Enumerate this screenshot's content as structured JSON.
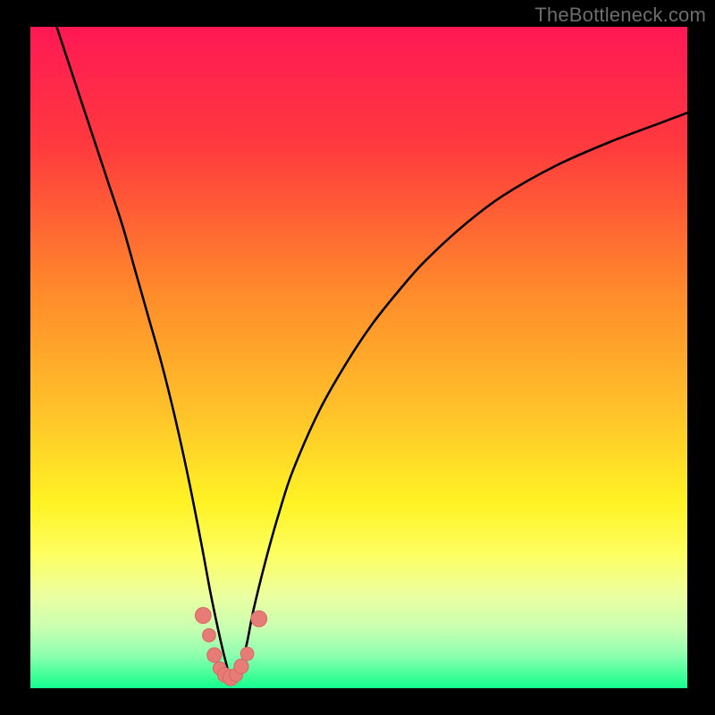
{
  "watermark": "TheBottleneck.com",
  "colors": {
    "frame": "#000000",
    "watermark": "#6d6d6d",
    "curve": "#000000",
    "marker_fill": "#e77c77",
    "marker_stroke": "#d86a64"
  },
  "chart_data": {
    "type": "line",
    "title": "",
    "xlabel": "",
    "ylabel": "",
    "xlim": [
      0,
      100
    ],
    "ylim": [
      0,
      100
    ],
    "grid": false,
    "legend": false,
    "gradient_stops": [
      {
        "offset": 0,
        "color": "#ff1854"
      },
      {
        "offset": 18,
        "color": "#ff3a3e"
      },
      {
        "offset": 40,
        "color": "#ff8a2b"
      },
      {
        "offset": 58,
        "color": "#ffc22a"
      },
      {
        "offset": 72,
        "color": "#fff324"
      },
      {
        "offset": 80,
        "color": "#fdff63"
      },
      {
        "offset": 86,
        "color": "#ecffa0"
      },
      {
        "offset": 91,
        "color": "#c7ffb1"
      },
      {
        "offset": 95,
        "color": "#8effaf"
      },
      {
        "offset": 99,
        "color": "#2bff93"
      },
      {
        "offset": 100,
        "color": "#16fd92"
      }
    ],
    "series": [
      {
        "name": "bottleneck-curve",
        "x": [
          4,
          6,
          8,
          10,
          12,
          14,
          16,
          18,
          20,
          22,
          24,
          26,
          27.5,
          29,
          30,
          30.5,
          31,
          32,
          33,
          34,
          36,
          38,
          40,
          44,
          48,
          52,
          56,
          60,
          66,
          72,
          80,
          88,
          96,
          100
        ],
        "values": [
          100,
          94,
          88,
          82,
          76,
          70,
          63,
          56,
          49,
          41,
          32,
          22,
          14,
          7,
          3,
          1.5,
          1.5,
          3,
          7,
          12,
          20,
          27,
          33,
          42,
          49,
          55,
          60,
          64.5,
          70,
          74.5,
          79,
          82.5,
          85.5,
          87
        ]
      }
    ],
    "markers": [
      {
        "x": 26.3,
        "y": 11.0,
        "r": 1.2
      },
      {
        "x": 27.2,
        "y": 8.0,
        "r": 1.0
      },
      {
        "x": 28.0,
        "y": 5.0,
        "r": 1.1
      },
      {
        "x": 28.8,
        "y": 3.0,
        "r": 1.0
      },
      {
        "x": 29.6,
        "y": 2.0,
        "r": 1.1
      },
      {
        "x": 30.5,
        "y": 1.6,
        "r": 1.2
      },
      {
        "x": 31.3,
        "y": 2.0,
        "r": 1.0
      },
      {
        "x": 32.1,
        "y": 3.3,
        "r": 1.1
      },
      {
        "x": 33.0,
        "y": 5.2,
        "r": 1.0
      },
      {
        "x": 34.8,
        "y": 10.5,
        "r": 1.2
      }
    ]
  }
}
